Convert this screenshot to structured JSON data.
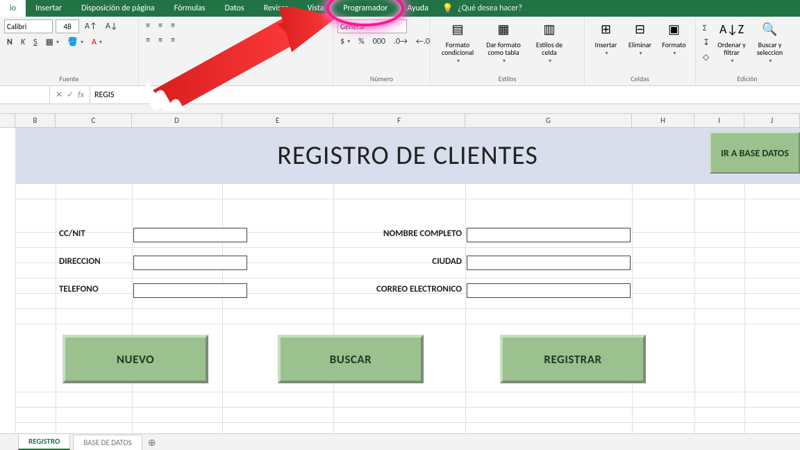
{
  "ribbon": {
    "tabs": [
      "io",
      "Insertar",
      "Disposición de página",
      "Fórmulas",
      "Datos",
      "Revisar",
      "Vista",
      "Programador",
      "Ayuda"
    ],
    "tellme_placeholder": "¿Qué desea hacer?",
    "font": {
      "name": "Calibri",
      "size": "48",
      "group_label": "Fuente"
    },
    "alignment": {
      "group_label": ""
    },
    "number": {
      "format": "General",
      "group_label": "Número"
    },
    "styles": {
      "cond": "Formato condicional",
      "table": "Dar formato como tabla",
      "cell": "Estilos de celda",
      "group_label": "Estilos"
    },
    "cells": {
      "insert": "Insertar",
      "delete": "Eliminar",
      "format": "Formato",
      "group_label": "Celdas"
    },
    "editing": {
      "sort": "Ordenar y filtrar",
      "find": "Buscar y seleccion",
      "group_label": "Edición"
    }
  },
  "formula_bar": {
    "namebox": "",
    "value": "REGIS"
  },
  "columns": [
    "B",
    "C",
    "D",
    "E",
    "F",
    "G",
    "H",
    "I",
    "J"
  ],
  "banner": {
    "title": "REGISTRO DE CLIENTES",
    "goto": "IR A BASE DATOS"
  },
  "form": {
    "ccnit": "CC/NIT",
    "direccion": "DIRECCION",
    "telefono": "TELEFONO",
    "nombre": "NOMBRE COMPLETO",
    "ciudad": "CIUDAD",
    "correo": "CORREO ELECTRONICO"
  },
  "actions": {
    "nuevo": "NUEVO",
    "buscar": "BUSCAR",
    "registrar": "REGISTRAR"
  },
  "sheet_tabs": {
    "active": "REGISTRO",
    "other": "BASE DE DATOS"
  }
}
